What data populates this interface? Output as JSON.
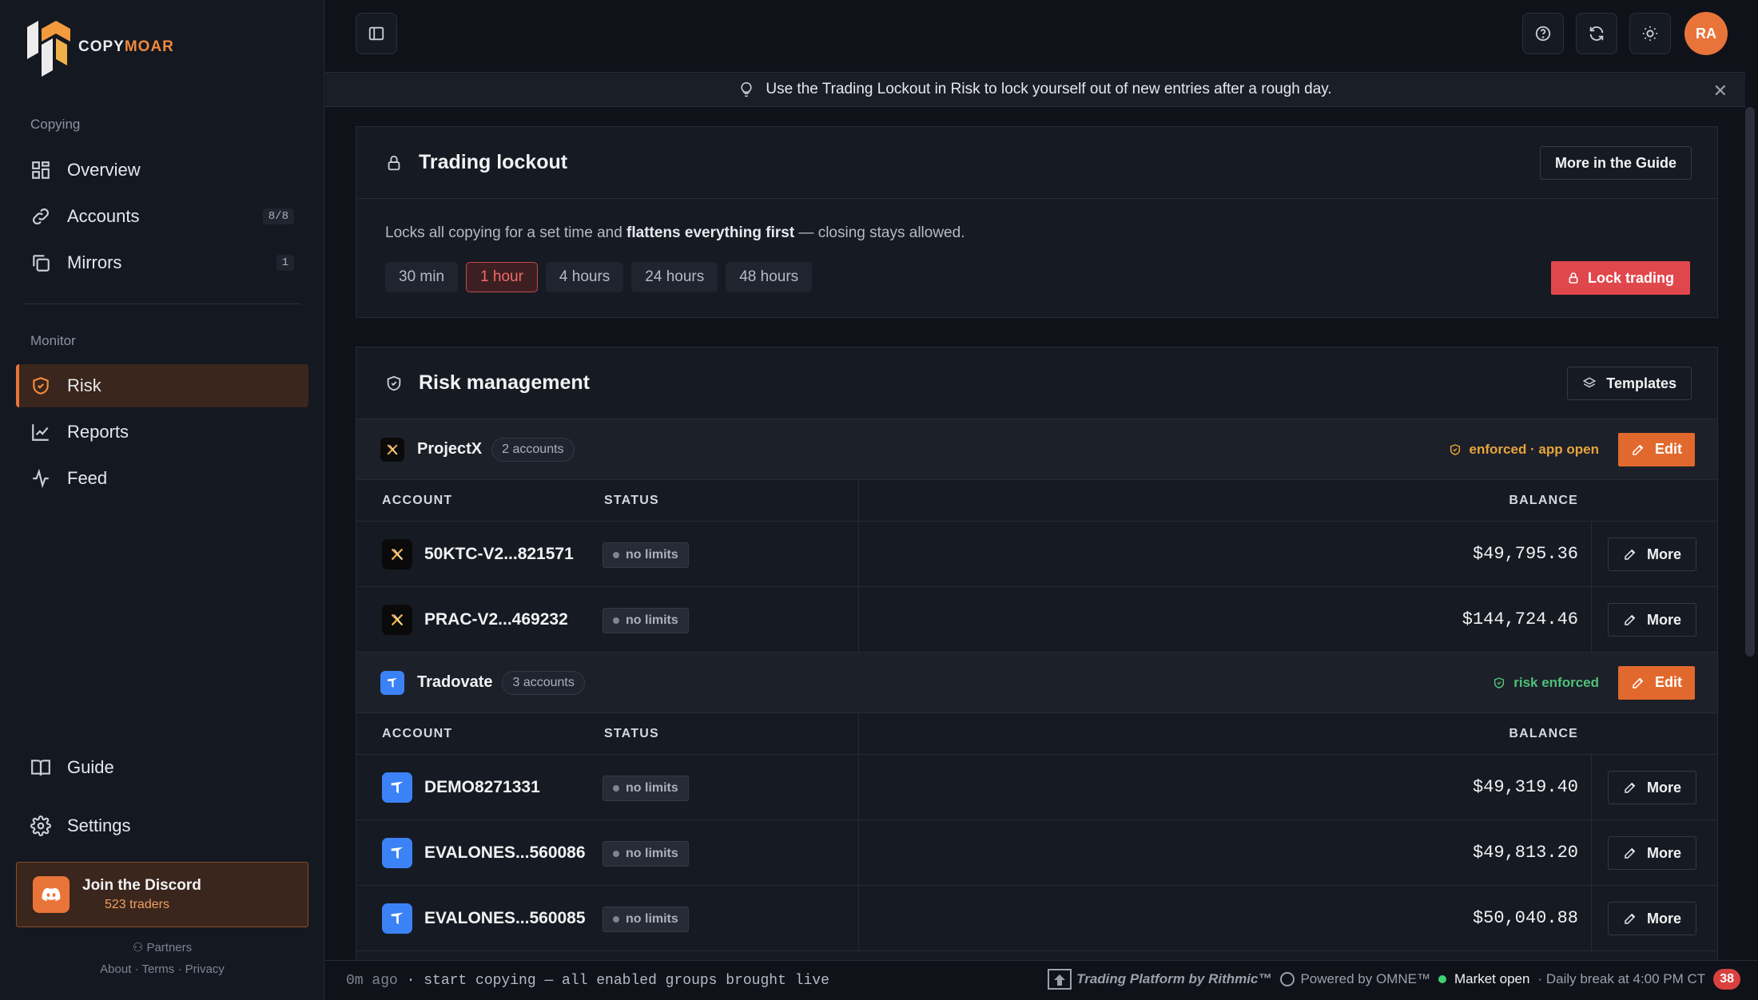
{
  "app": {
    "logo_a": "COPY",
    "logo_b": "MOAR"
  },
  "sidebar": {
    "copying_label": "Copying",
    "monitor_label": "Monitor",
    "items": [
      {
        "label": "Overview",
        "icon": "grid-icon"
      },
      {
        "label": "Accounts",
        "icon": "link-icon",
        "count": "8/8"
      },
      {
        "label": "Mirrors",
        "icon": "copy-icon",
        "count": "1"
      },
      {
        "label": "Risk",
        "icon": "shield-icon"
      },
      {
        "label": "Reports",
        "icon": "chart-line-icon"
      },
      {
        "label": "Feed",
        "icon": "activity-icon"
      }
    ],
    "guide": "Guide",
    "settings": "Settings",
    "discord_title": "Join the Discord",
    "discord_sub": "523 traders",
    "partners": "Partners",
    "about": "About",
    "terms": "Terms",
    "privacy": "Privacy"
  },
  "topbar": {
    "avatar": "RA"
  },
  "banner": {
    "text": "Use the Trading Lockout in Risk to lock yourself out of new entries after a rough day."
  },
  "lockout": {
    "title": "Trading lockout",
    "guide_btn": "More in the Guide",
    "desc_a": "Locks all copying for a set time and ",
    "desc_b": "flattens everything first",
    "desc_c": " — closing stays allowed.",
    "durations": [
      "30 min",
      "1 hour",
      "4 hours",
      "24 hours",
      "48 hours"
    ],
    "selected": "1 hour",
    "lock_btn": "Lock trading"
  },
  "risk": {
    "title": "Risk management",
    "templates_btn": "Templates",
    "col_account": "ACCOUNT",
    "col_status": "STATUS",
    "col_balance": "BALANCE",
    "more_label": "More",
    "edit_label": "Edit",
    "groups": [
      {
        "name": "ProjectX",
        "count": "2 accounts",
        "status": "enforced · app open",
        "status_color": "#e8a33a",
        "rows": [
          {
            "name": "50KTC-V2...821571",
            "status": "no limits",
            "balance": "$49,795.36"
          },
          {
            "name": "PRAC-V2...469232",
            "status": "no limits",
            "balance": "$144,724.46"
          }
        ]
      },
      {
        "name": "Tradovate",
        "count": "3 accounts",
        "status": "risk enforced",
        "status_color": "#4fc07a",
        "rows": [
          {
            "name": "DEMO8271331",
            "status": "no limits",
            "balance": "$49,319.40"
          },
          {
            "name": "EVALONES...560086",
            "status": "no limits",
            "balance": "$49,813.20"
          },
          {
            "name": "EVALONES...560085",
            "status": "no limits",
            "balance": "$50,040.88"
          }
        ]
      }
    ]
  },
  "statusbar": {
    "ago": "0m ago",
    "log": " · start copying — all enabled groups brought live",
    "rithmic": "Trading Platform by Rithmic™",
    "omne": "Powered by OMNE™",
    "market": "Market open",
    "break": "· Daily break at 4:00 PM CT",
    "badge": "38"
  }
}
